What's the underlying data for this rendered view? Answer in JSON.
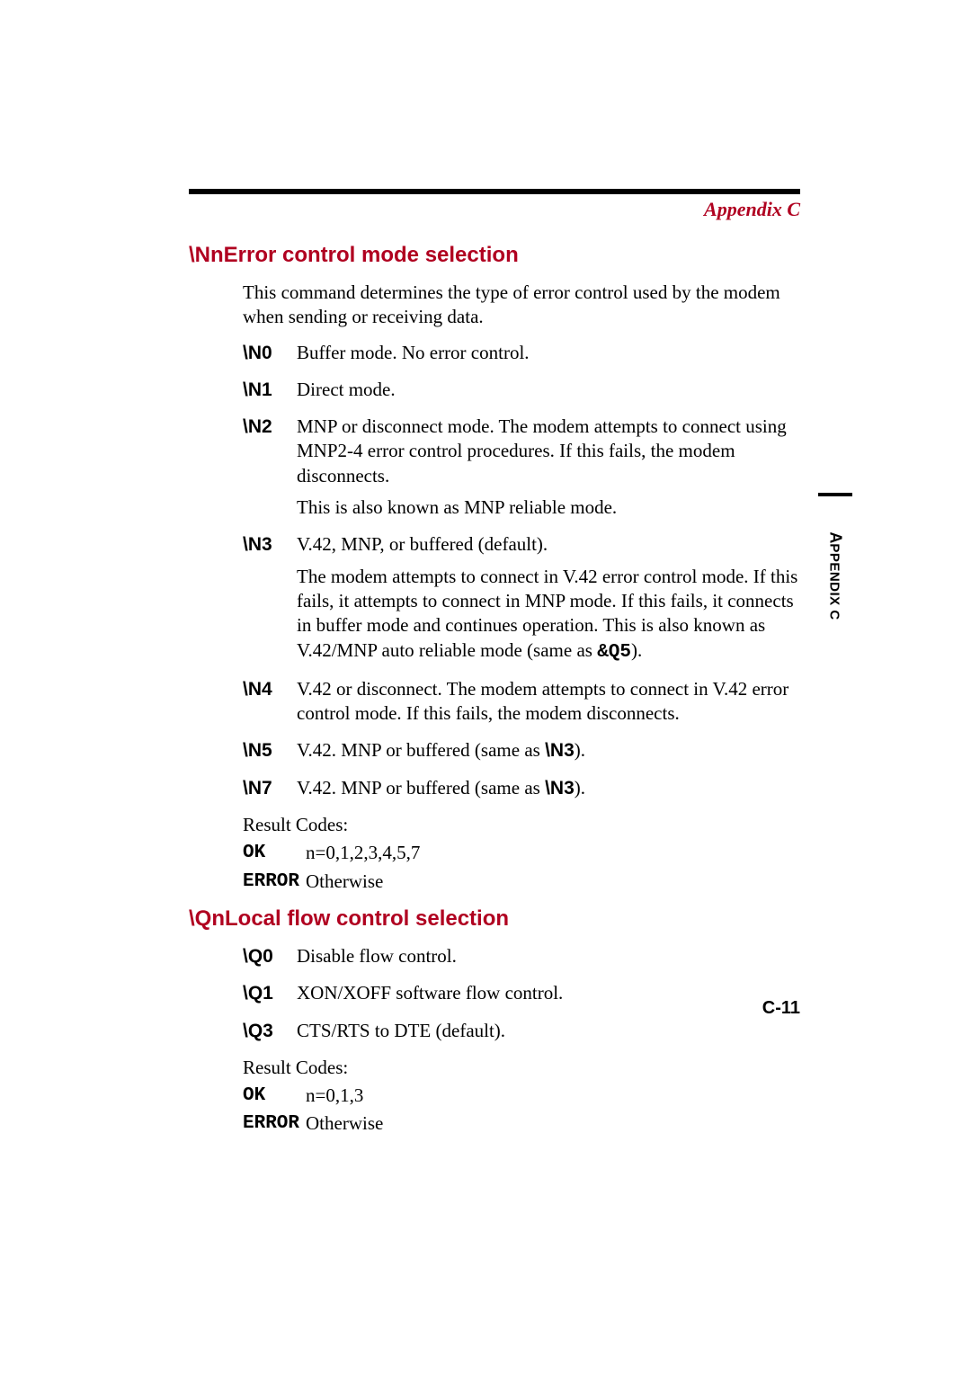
{
  "header": {
    "label": "Appendix C"
  },
  "section1": {
    "title": "\\NnError control mode selection",
    "intro": "This command determines the type of error control used by the modem when sending or receiving data.",
    "items": [
      {
        "code": "\\N0",
        "p1": "Buffer mode. No error control."
      },
      {
        "code": "\\N1",
        "p1": "Direct mode."
      },
      {
        "code": "\\N2",
        "p1": "MNP or disconnect mode. The modem attempts to connect using MNP2-4 error control procedures. If this fails, the modem disconnects.",
        "p2": "This is also known as MNP reliable mode."
      },
      {
        "code": "\\N3",
        "p1": "V.42, MNP, or buffered (default).",
        "p2_pre": "The modem attempts to connect in V.42 error control mode. If this fails, it attempts to connect in MNP mode. If this fails, it connects in buffer mode and continues operation. This is also known as V.42/MNP auto reliable mode (same as ",
        "p2_bold": "&Q5",
        "p2_post": ")."
      },
      {
        "code": "\\N4",
        "p1": "V.42 or disconnect. The modem attempts to connect in V.42 error control mode. If this fails, the modem disconnects."
      },
      {
        "code": "\\N5",
        "p1_pre": "V.42. MNP or buffered (same as ",
        "p1_bold": "\\N3",
        "p1_post": ")."
      },
      {
        "code": "\\N7",
        "p1_pre": "V.42. MNP or buffered (same as ",
        "p1_bold": "\\N3",
        "p1_post": ")."
      }
    ],
    "result_label": "Result Codes:",
    "results": [
      {
        "code": "OK",
        "desc": "n=0,1,2,3,4,5,7"
      },
      {
        "code": "ERROR",
        "desc": "Otherwise"
      }
    ]
  },
  "section2": {
    "title": "\\QnLocal flow control selection",
    "items": [
      {
        "code": "\\Q0",
        "p1": "Disable flow control."
      },
      {
        "code": "\\Q1",
        "p1": "XON/XOFF software flow control."
      },
      {
        "code": "\\Q3",
        "p1": "CTS/RTS to DTE (default)."
      }
    ],
    "result_label": "Result Codes:",
    "results": [
      {
        "code": "OK",
        "desc": "n=0,1,3"
      },
      {
        "code": "ERROR",
        "desc": "Otherwise"
      }
    ]
  },
  "sidetab": {
    "a": "A",
    "rest": "PPENDIX C"
  },
  "page_number": "C-11"
}
